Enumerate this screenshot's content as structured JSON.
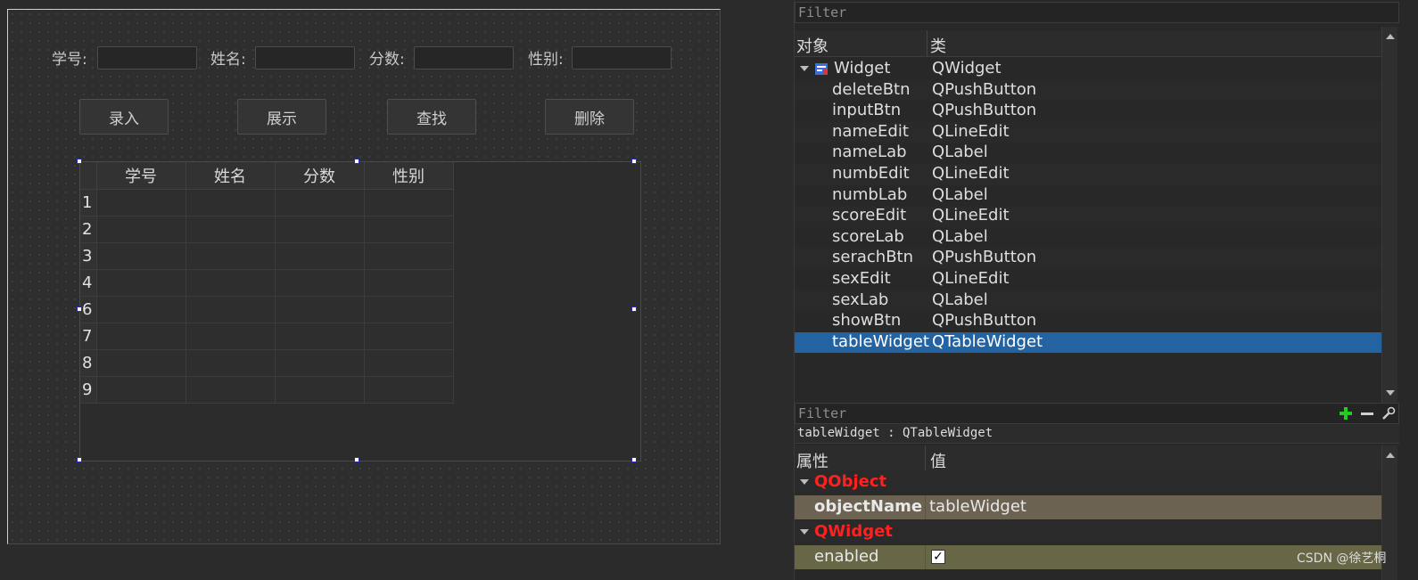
{
  "form": {
    "labels": {
      "numb": "学号:",
      "name": "姓名:",
      "score": "分数:",
      "sex": "性别:"
    },
    "buttons": {
      "input": "录入",
      "show": "展示",
      "search": "查找",
      "delete": "删除"
    },
    "table": {
      "headers": [
        "学号",
        "姓名",
        "分数",
        "性别"
      ],
      "row_labels": [
        "1",
        "2",
        "3",
        "4",
        "6",
        "7",
        "8",
        "9"
      ]
    }
  },
  "object_inspector": {
    "filter_placeholder": "Filter",
    "col_object": "对象",
    "col_class": "类",
    "rows": [
      {
        "name": "Widget",
        "class": "QWidget"
      },
      {
        "name": "deleteBtn",
        "class": "QPushButton"
      },
      {
        "name": "inputBtn",
        "class": "QPushButton"
      },
      {
        "name": "nameEdit",
        "class": "QLineEdit"
      },
      {
        "name": "nameLab",
        "class": "QLabel"
      },
      {
        "name": "numbEdit",
        "class": "QLineEdit"
      },
      {
        "name": "numbLab",
        "class": "QLabel"
      },
      {
        "name": "scoreEdit",
        "class": "QLineEdit"
      },
      {
        "name": "scoreLab",
        "class": "QLabel"
      },
      {
        "name": "serachBtn",
        "class": "QPushButton"
      },
      {
        "name": "sexEdit",
        "class": "QLineEdit"
      },
      {
        "name": "sexLab",
        "class": "QLabel"
      },
      {
        "name": "showBtn",
        "class": "QPushButton"
      },
      {
        "name": "tableWidget",
        "class": "QTableWidget"
      }
    ],
    "selected": "tableWidget"
  },
  "property_editor": {
    "filter_placeholder": "Filter",
    "object_label": "tableWidget : QTableWidget",
    "col_property": "属性",
    "col_value": "值",
    "group_qobject": "QObject",
    "object_name_label": "objectName",
    "object_name_value": "tableWidget",
    "group_qwidget": "QWidget",
    "enabled_label": "enabled",
    "enabled_value": true,
    "enabled_mark": "✓"
  },
  "watermark": "CSDN @徐艺桐",
  "colors": {
    "selection": "#2463a2",
    "group_header": "#ff2020",
    "add_icon": "#22cc22"
  }
}
